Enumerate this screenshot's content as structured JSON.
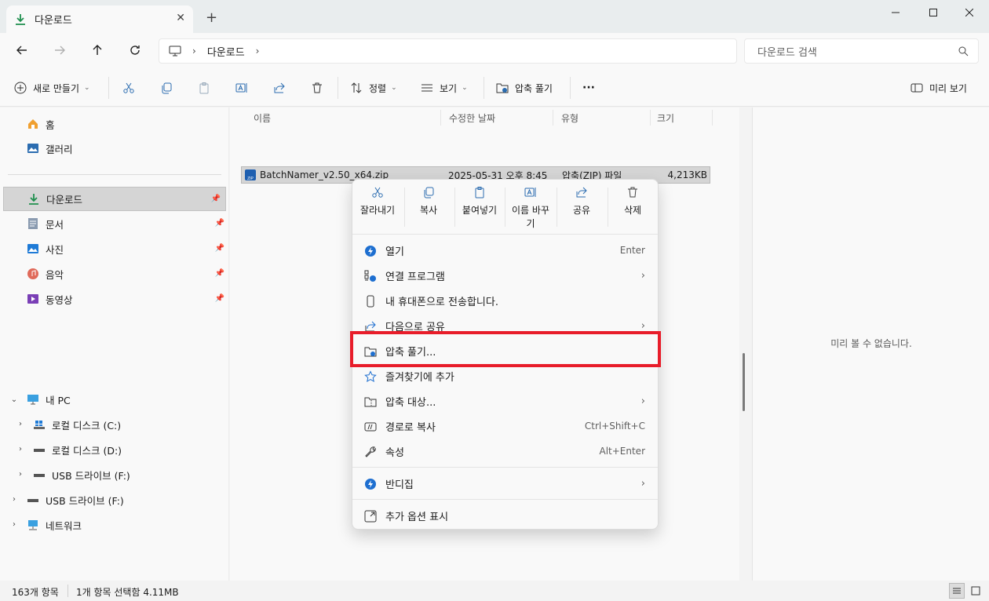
{
  "window": {
    "tab_title": "다운로드",
    "new_tab": "+",
    "close_tab": "✕"
  },
  "address": {
    "crumb": "다운로드",
    "search_placeholder": "다운로드 검색"
  },
  "toolbar": {
    "new": "새로 만들기",
    "sort": "정렬",
    "view": "보기",
    "extract": "압축 풀기",
    "more": "···",
    "preview": "미리 보기"
  },
  "sidebar": {
    "home": "홈",
    "gallery": "갤러리",
    "downloads": "다운로드",
    "documents": "문서",
    "pictures": "사진",
    "music": "음악",
    "videos": "동영상",
    "this_pc": "내 PC",
    "drive_c": "로컬 디스크 (C:)",
    "drive_d": "로컬 디스크 (D:)",
    "usb_f_child": "USB 드라이브 (F:)",
    "usb_f": "USB 드라이브 (F:)",
    "network": "네트워크"
  },
  "columns": {
    "name": "이름",
    "modified": "수정한 날짜",
    "type": "유형",
    "size": "크기"
  },
  "file": {
    "name": "BatchNamer_v2.50_x64.zip",
    "date": "2025-05-31 오후 8:45",
    "type": "압축(ZIP) 파일",
    "size": "4,213KB"
  },
  "context_menu": {
    "quick": {
      "cut": "잘라내기",
      "copy": "복사",
      "paste": "붙여넣기",
      "rename_1": "이름 바꾸",
      "rename_2": "기",
      "share": "공유",
      "delete": "삭제"
    },
    "open": "열기",
    "open_key": "Enter",
    "open_with": "연결 프로그램",
    "send_phone": "내 휴대폰으로 전송합니다.",
    "share_with": "다음으로 공유",
    "extract": "압축 풀기...",
    "favorite": "즐겨찾기에 추가",
    "compress": "압축 대상...",
    "copy_path": "경로로 복사",
    "copy_path_key": "Ctrl+Shift+C",
    "properties": "속성",
    "properties_key": "Alt+Enter",
    "bandizip": "반디집",
    "more_options": "추가 옵션 표시"
  },
  "preview": {
    "message": "미리 볼 수 없습니다."
  },
  "status": {
    "count": "163개 항목",
    "selected": "1개 항목 선택함 4.11MB"
  },
  "colors": {
    "highlight": "#e81d2a",
    "accent": "#0067c0",
    "selection": "#d5d5d5"
  }
}
